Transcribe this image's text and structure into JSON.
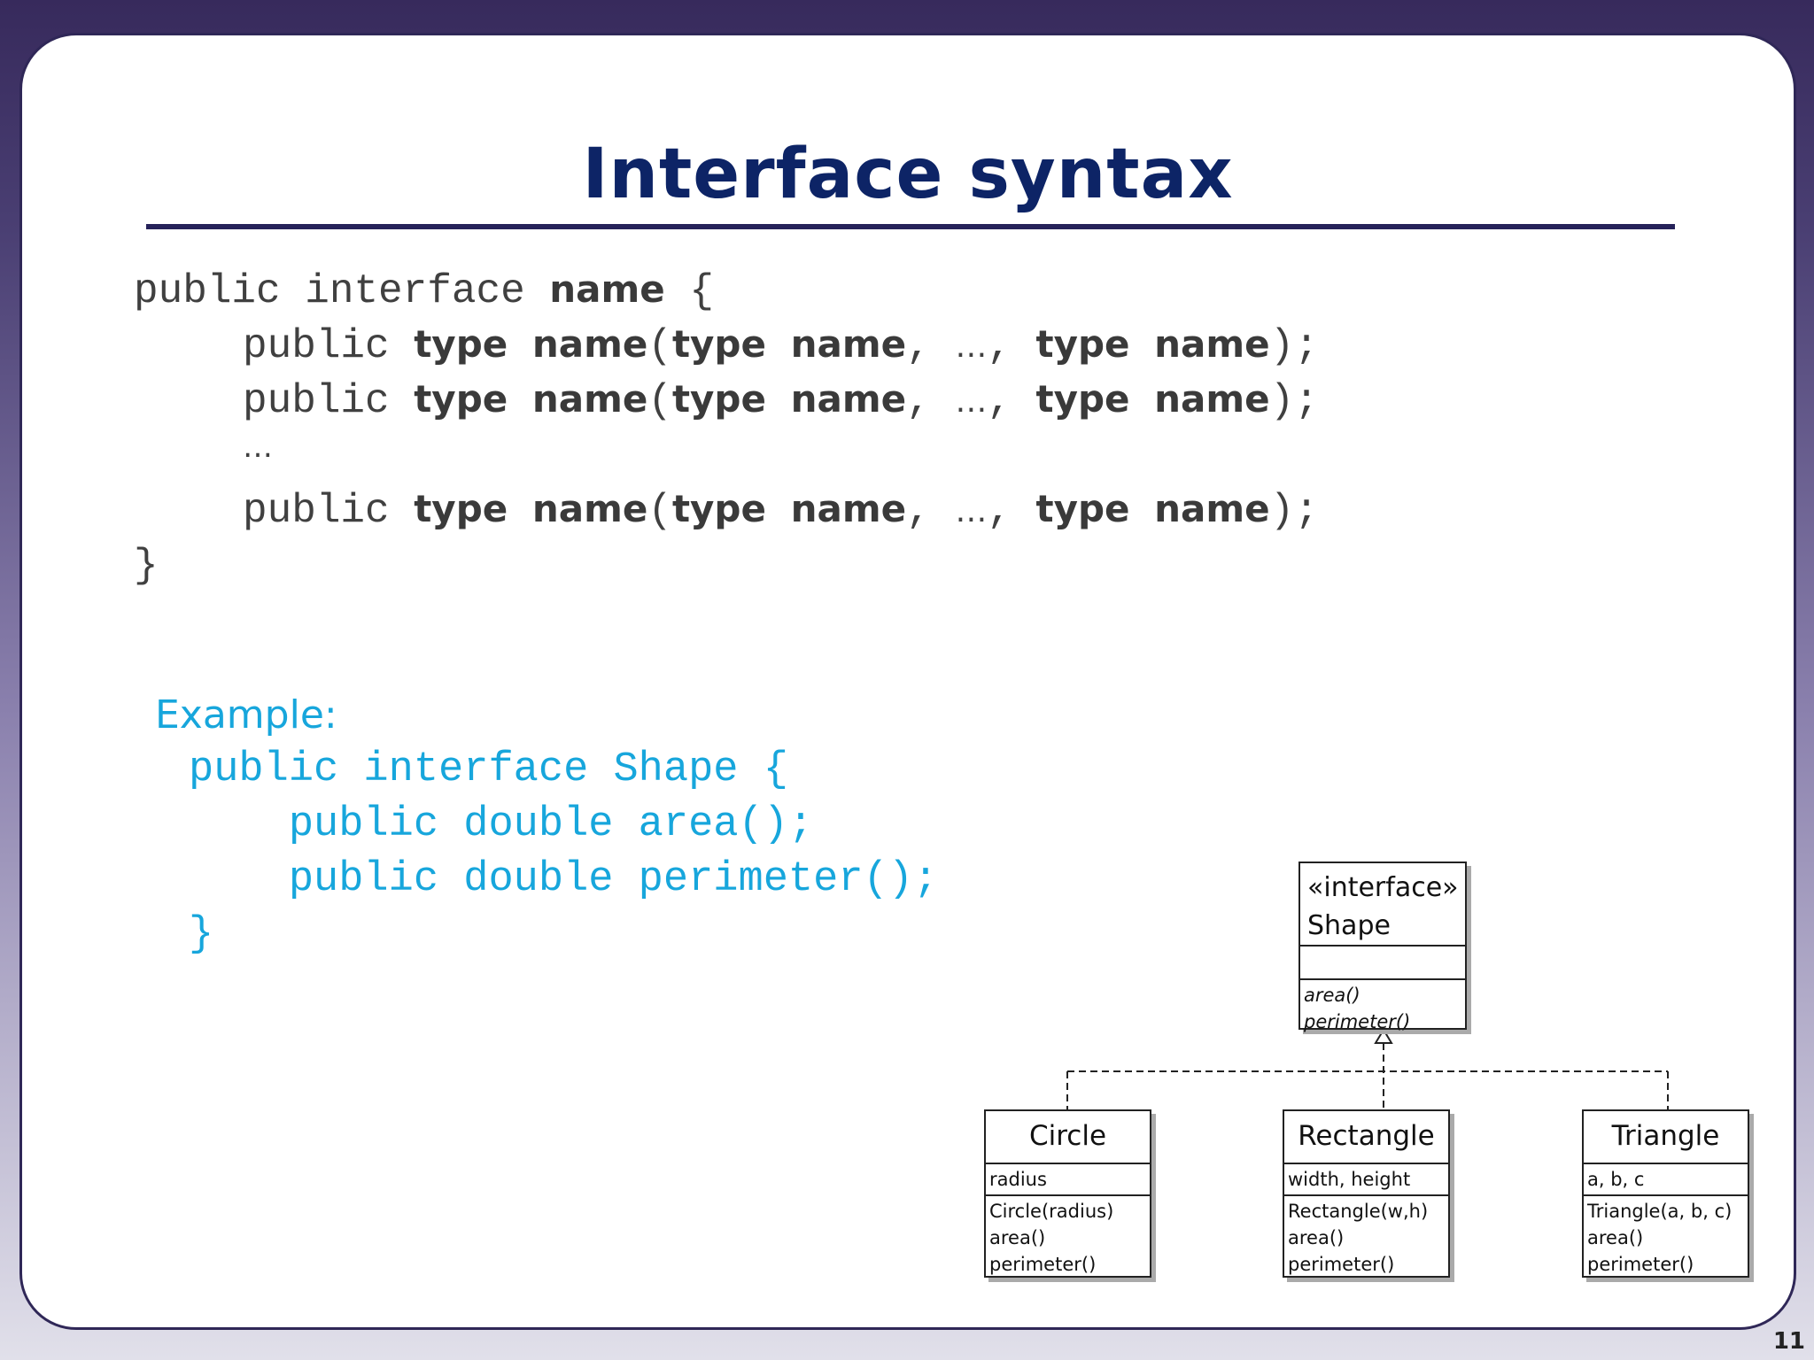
{
  "slide": {
    "title": "Interface syntax",
    "page_number": "11"
  },
  "syntax": {
    "line1": {
      "a": "public interface ",
      "b": "name",
      "c": " {"
    },
    "method_line": {
      "public": "public ",
      "type": "type",
      "name": "name",
      "open": "(",
      "type2": "type",
      "name2": "name",
      "comma": ",",
      "ellipsis": "…",
      "comma2": ",",
      "type3": "type",
      "name3": "name",
      "close": ");"
    },
    "ellipsis_line": "…",
    "closing": "}"
  },
  "example": {
    "label": "Example:",
    "lines": [
      "public interface Shape {",
      "    public double area();",
      "    public double perimeter();",
      "}"
    ]
  },
  "uml": {
    "interface": {
      "stereotype": "«interface»",
      "name": "Shape",
      "methods": [
        "area()",
        "perimeter()"
      ]
    },
    "classes": [
      {
        "name": "Circle",
        "fields": "radius",
        "methods": [
          "Circle(radius)",
          "area()",
          "perimeter()"
        ]
      },
      {
        "name": "Rectangle",
        "fields": "width, height",
        "methods": [
          "Rectangle(w,h)",
          "area()",
          "perimeter()"
        ]
      },
      {
        "name": "Triangle",
        "fields": "a, b, c",
        "methods": [
          "Triangle(a, b, c)",
          "area()",
          "perimeter()"
        ]
      }
    ]
  },
  "colors": {
    "title": "#0d2466",
    "accent": "#17a6dc",
    "code": "#404040",
    "frame": "#372a5c"
  }
}
